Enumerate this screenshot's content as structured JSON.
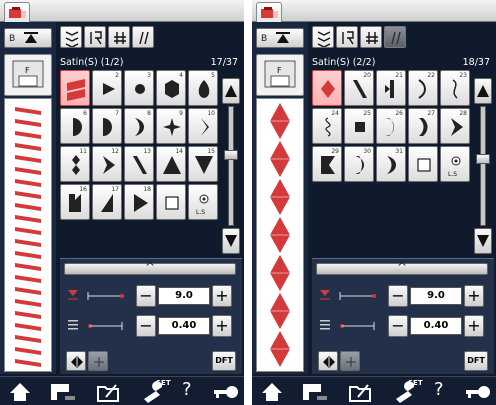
{
  "colors": {
    "panel_bg": "#0f1a2c",
    "stitch_red": "#d43a3a",
    "selected_cell": "#ffb2b2"
  },
  "screens": [
    {
      "feed_letter": "B",
      "foot_letter": "F",
      "category_label": "Satin(S) (1/2)",
      "counter": "17/37",
      "selected_index": 0,
      "stitches": [
        {
          "num": "",
          "icon": "zigzag-block-icon"
        },
        {
          "num": "2",
          "icon": "triangle-right-small-icon"
        },
        {
          "num": "3",
          "icon": "dot-icon"
        },
        {
          "num": "4",
          "icon": "hexagon-icon"
        },
        {
          "num": "5",
          "icon": "drop-icon"
        },
        {
          "num": "6",
          "icon": "half-disc-icon"
        },
        {
          "num": "7",
          "icon": "half-moon-icon"
        },
        {
          "num": "8",
          "icon": "crescent-icon"
        },
        {
          "num": "9",
          "icon": "star-icon"
        },
        {
          "num": "10",
          "icon": "bracket-icon"
        },
        {
          "num": "11",
          "icon": "diamond-stack-icon"
        },
        {
          "num": "12",
          "icon": "chevron-right-icon"
        },
        {
          "num": "13",
          "icon": "slant-icon"
        },
        {
          "num": "14",
          "icon": "triangle-up-icon"
        },
        {
          "num": "15",
          "icon": "triangle-down-icon"
        },
        {
          "num": "16",
          "icon": "trapezoid-icon"
        },
        {
          "num": "17",
          "icon": "ramp-icon"
        },
        {
          "num": "18",
          "icon": "play-icon"
        },
        {
          "num": "",
          "icon": "square-icon"
        },
        {
          "num": "",
          "icon": "ls-icon",
          "text": "L.S"
        }
      ],
      "width_value": "9.0",
      "length_value": "0.40",
      "dft_label": "DFT",
      "tab4_dim": false
    },
    {
      "feed_letter": "B",
      "foot_letter": "F",
      "category_label": "Satin(S) (2/2)",
      "counter": "18/37",
      "selected_index": 0,
      "stitches": [
        {
          "num": "",
          "icon": "diamond-icon"
        },
        {
          "num": "20",
          "icon": "slash-icon"
        },
        {
          "num": "21",
          "icon": "split-icon"
        },
        {
          "num": "22",
          "icon": "bow-icon"
        },
        {
          "num": "23",
          "icon": "wave-icon"
        },
        {
          "num": "24",
          "icon": "squiggle-icon"
        },
        {
          "num": "25",
          "icon": "square-small-icon"
        },
        {
          "num": "26",
          "icon": "arch-icon"
        },
        {
          "num": "27",
          "icon": "double-arch-icon"
        },
        {
          "num": "28",
          "icon": "chevron-right-icon"
        },
        {
          "num": "29",
          "icon": "tab-icon"
        },
        {
          "num": "30",
          "icon": "curve-icon"
        },
        {
          "num": "31",
          "icon": "moon-icon"
        },
        {
          "num": "",
          "icon": "square-icon"
        },
        {
          "num": "",
          "icon": "ls-icon",
          "text": "L.S"
        }
      ],
      "width_value": "9.0",
      "length_value": "0.40",
      "dft_label": "DFT",
      "tab4_dim": true
    }
  ],
  "nav": {
    "set_label": "SET",
    "help_label": "?"
  }
}
